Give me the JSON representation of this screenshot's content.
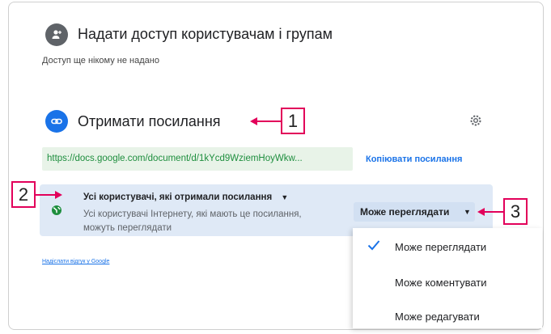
{
  "share_people": {
    "title": "Надати доступ користувачам і групам",
    "subtitle": "Доступ ще нікому не надано",
    "icon": "person-add-icon"
  },
  "get_link": {
    "title": "Отримати посилання",
    "icon": "link-icon",
    "url": "https://docs.google.com/document/d/1kYcd9WziemHoyWkw...",
    "copy_label": "Копіювати посилання",
    "settings_icon": "gear-icon"
  },
  "access": {
    "title": "Усі користувачі, які отримали посилання",
    "description": "Усі користувачі Інтернету, які мають це посилання, можуть переглядати",
    "role_button": "Може переглядати",
    "icon": "globe-icon"
  },
  "role_menu": {
    "items": [
      {
        "label": "Може переглядати",
        "selected": true
      },
      {
        "label": "Може коментувати",
        "selected": false
      },
      {
        "label": "Може редагувати",
        "selected": false
      }
    ]
  },
  "feedback": {
    "label": "Надіслати відгук у Google"
  },
  "callouts": {
    "one": "1",
    "two": "2",
    "three": "3"
  },
  "colors": {
    "accent": "#1a73e8",
    "link_green": "#1e8e3e",
    "callout": "#e2005a"
  }
}
